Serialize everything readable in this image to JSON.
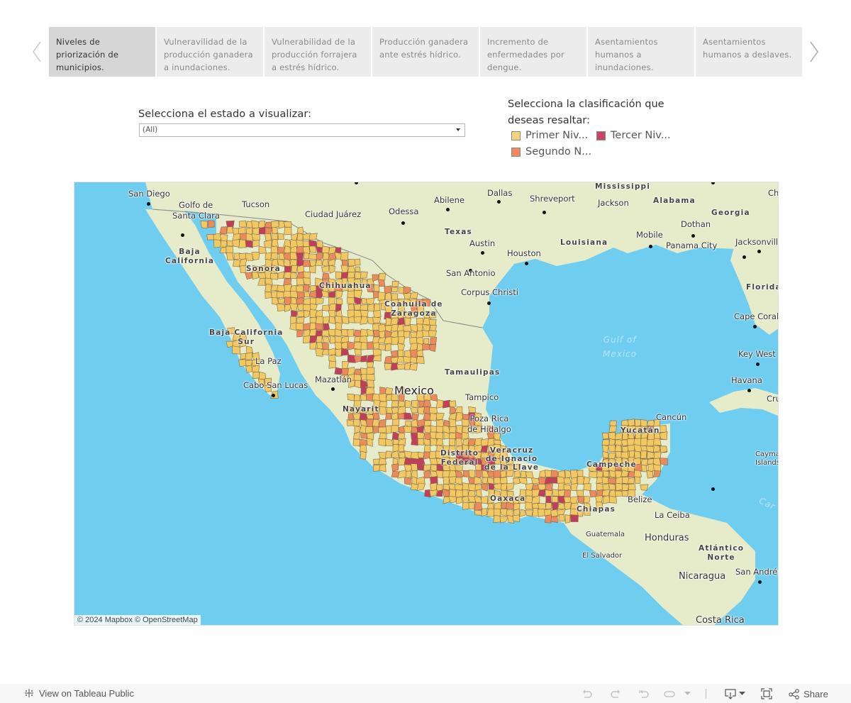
{
  "story": {
    "tabs": [
      {
        "label": "Niveles de priorización de municipios.",
        "active": true
      },
      {
        "label": "Vulneravilidad de la producción ganadera a inundaciones.",
        "active": false
      },
      {
        "label": "Vulnerabilidad de la producción forrajera a estrés hídrico.",
        "active": false
      },
      {
        "label": "Producción ganadera ante estrés hídrico.",
        "active": false
      },
      {
        "label": "Incremento de enfermedades por dengue.",
        "active": false
      },
      {
        "label": "Asentamientos humanos a inundaciones.",
        "active": false
      },
      {
        "label": "Asentamientos humanos a deslaves.",
        "active": false
      }
    ],
    "prev_icon": "chevron-left-icon",
    "next_icon": "chevron-right-icon"
  },
  "filter": {
    "label": "Selecciona el estado a visualizar:",
    "selected": "(All)"
  },
  "legend": {
    "title": "Selecciona la clasificación que deseas resaltar:",
    "items": [
      {
        "label": "Primer Niv...",
        "color": "#f5d27f"
      },
      {
        "label": "Tercer Niv...",
        "color": "#c6475f"
      },
      {
        "label": "Segundo N...",
        "color": "#ee8b61"
      }
    ]
  },
  "map": {
    "colors": {
      "water": "#6fcdef",
      "land": "#e6ebca",
      "primer": "#f2c862",
      "segundo": "#ec8a5c",
      "tercer": "#c23e5a"
    },
    "labels": {
      "san_diego": "San Diego",
      "golfo": "Golfo de",
      "santa_clara": "Santa Clara",
      "tucson": "Tucson",
      "ciudad_juarez": "Ciudad Juárez",
      "odessa": "Odessa",
      "abilene": "Abilene",
      "dallas": "Dallas",
      "shreveport": "Shreveport",
      "mississippi": "Mississippi",
      "jackson": "Jackson",
      "alabama": "Alabama",
      "georgia": "Georgia",
      "cha": "Cha",
      "texas": "Texas",
      "dothan": "Dothan",
      "mobile": "Mobile",
      "louisiana": "Louisiana",
      "austin": "Austin",
      "houston": "Houston",
      "panama_city": "Panama City",
      "jacksonville": "Jacksonville",
      "san_antonio": "San Antonio",
      "corpus_christi": "Corpus Christi",
      "florida": "Florida",
      "baja_california": "Baja\nCalifornia",
      "sonora": "Sonora",
      "chihuahua": "Chihuahua",
      "coahuila": "Coahuila de\nZaragoza",
      "cape_coral": "Cape Coral",
      "gulf": "Gulf of\nMexico",
      "bcs": "Baja California\nSur",
      "key_west": "Key West",
      "la_paz": "La Paz",
      "tamaulipas": "Tamaulipas",
      "havana": "Havana",
      "cabo": "Cabo San Lucas",
      "mazatlan": "Mazatlán",
      "mexico": "Mexico",
      "tampico": "Tampico",
      "cruces": "Cru",
      "nayarit": "Nayarit",
      "poza_rica": "Poza Rica\nde Hidalgo",
      "cancun": "Cancún",
      "yucatan": "Yucatán",
      "distrito": "Distrito\nFederal",
      "veracruz": "Veracruz\nde Ignacio\nde la Llave",
      "campeche": "Campeche",
      "cayman": "Cayman\nIslands",
      "oaxaca": "Oaxaca",
      "chiapas": "Chiapas",
      "belize": "Belize",
      "la_ceiba": "La Ceiba",
      "guatemala": "Guatemala",
      "honduras": "Honduras",
      "atlantico": "Atlántico\nNorte",
      "el_salvador": "El Salvador",
      "san_andres": "San Andrés",
      "nicaragua": "Nicaragua",
      "costa_rica": "Costa Rica",
      "caribbean": "Car"
    },
    "attribution": "© 2024 Mapbox  © OpenStreetMap"
  },
  "toolbar": {
    "view_label": "View on Tableau Public",
    "share_label": "Share"
  }
}
